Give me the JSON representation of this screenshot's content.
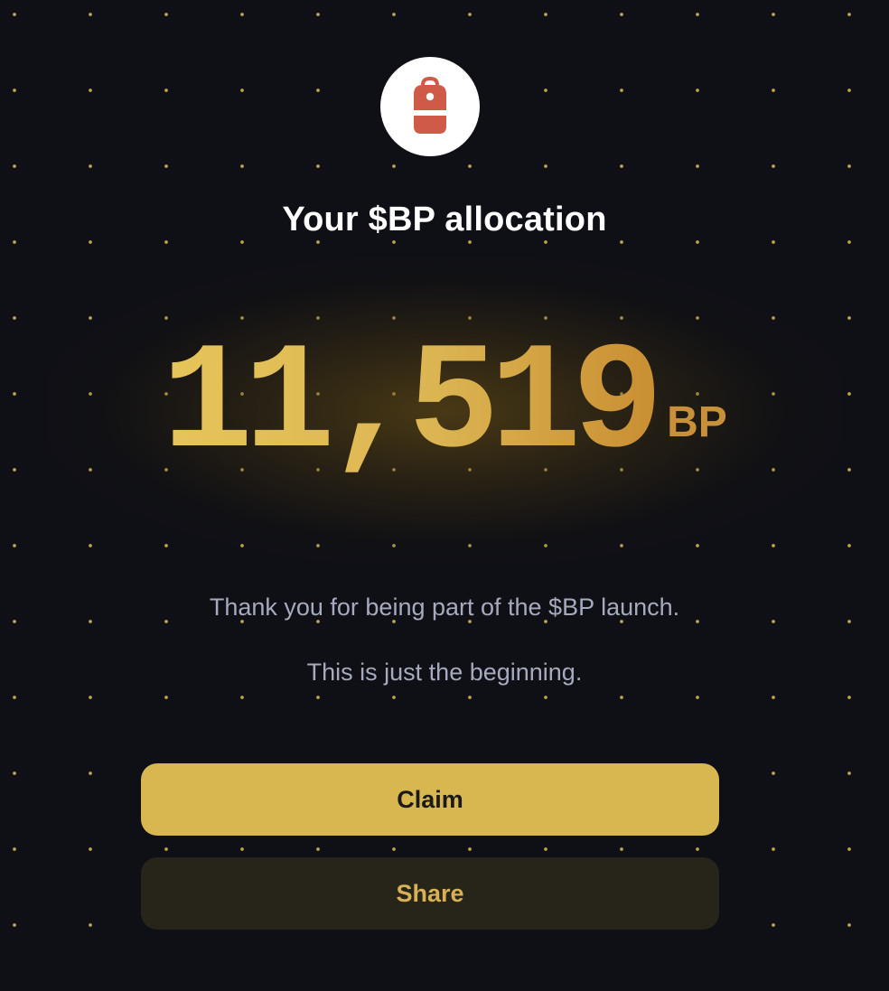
{
  "header": {
    "logo_icon": "backpack-icon",
    "title": "Your $BP allocation"
  },
  "allocation": {
    "amount": "11,519",
    "unit": "BP"
  },
  "messages": {
    "line1": "Thank you for being part of the $BP launch.",
    "line2": "This is just the beginning."
  },
  "actions": {
    "claim_label": "Claim",
    "share_label": "Share"
  },
  "colors": {
    "background": "#0f1016",
    "accent_gold": "#d8b650",
    "logo_red": "#cf5a47"
  }
}
